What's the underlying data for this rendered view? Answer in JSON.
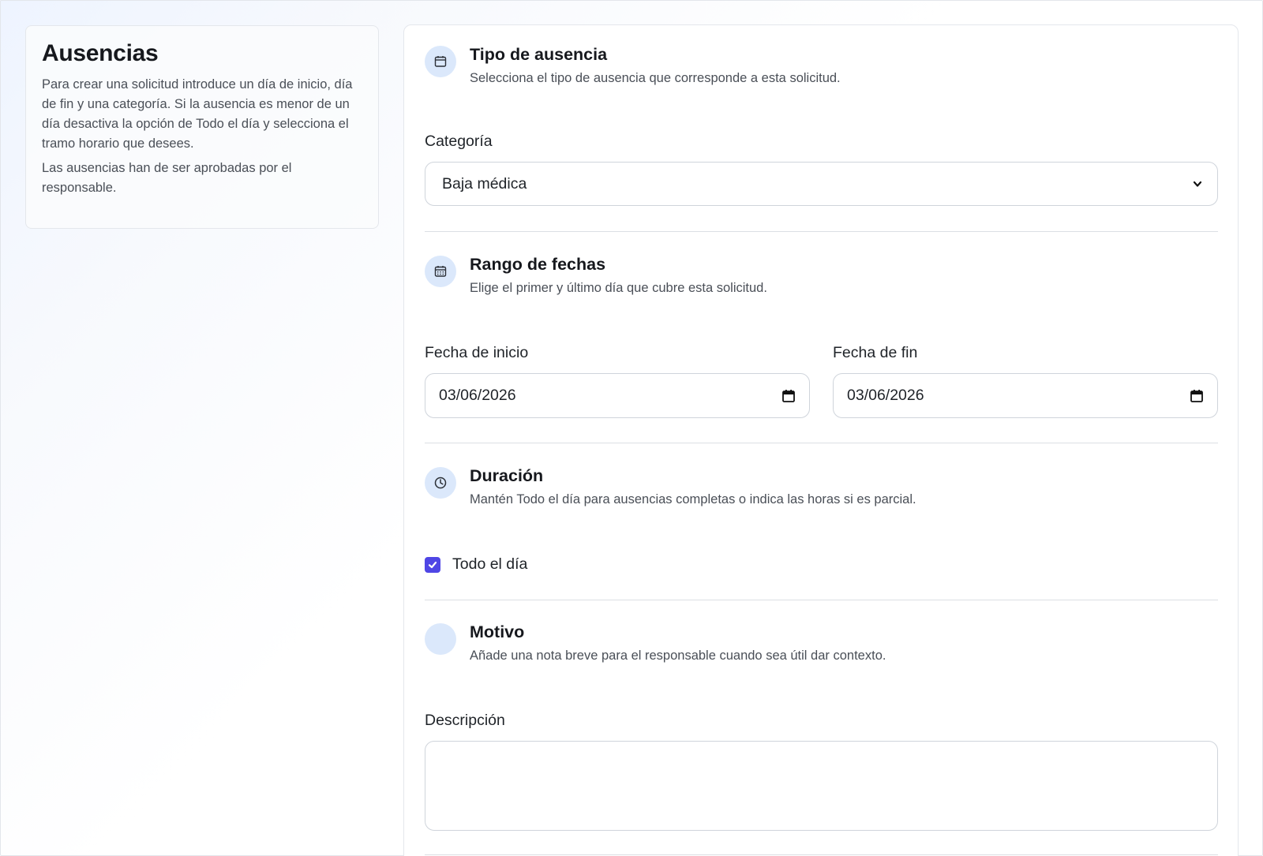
{
  "info": {
    "title": "Ausencias",
    "paragraph1": "Para crear una solicitud introduce un día de inicio, día de fin y una categoría. Si la ausencia es menor de un día desactiva la opción de Todo el día y selecciona el tramo horario que desees.",
    "paragraph2": "Las ausencias han de ser aprobadas por el responsable."
  },
  "sections": {
    "tipo": {
      "icon": "calendar-icon",
      "title": "Tipo de ausencia",
      "description": "Selecciona el tipo de ausencia que corresponde a esta solicitud.",
      "category_label": "Categoría",
      "category_value": "Baja médica"
    },
    "rango": {
      "icon": "calendar-grid-icon",
      "title": "Rango de fechas",
      "description": "Elige el primer y último día que cubre esta solicitud.",
      "start_label": "Fecha de inicio",
      "start_value": "03/06/2026",
      "end_label": "Fecha de fin",
      "end_value": "03/06/2026"
    },
    "duracion": {
      "icon": "clock-icon",
      "title": "Duración",
      "description": "Mantén Todo el día para ausencias completas o indica las horas si es parcial.",
      "all_day_label": "Todo el día",
      "all_day_checked": true
    },
    "motivo": {
      "title": "Motivo",
      "description": "Añade una nota breve para el responsable cuando sea útil dar contexto.",
      "description_label": "Descripción",
      "description_value": ""
    }
  },
  "colors": {
    "accent": "#4f46e5",
    "icon_bg": "#dbe8fb"
  }
}
